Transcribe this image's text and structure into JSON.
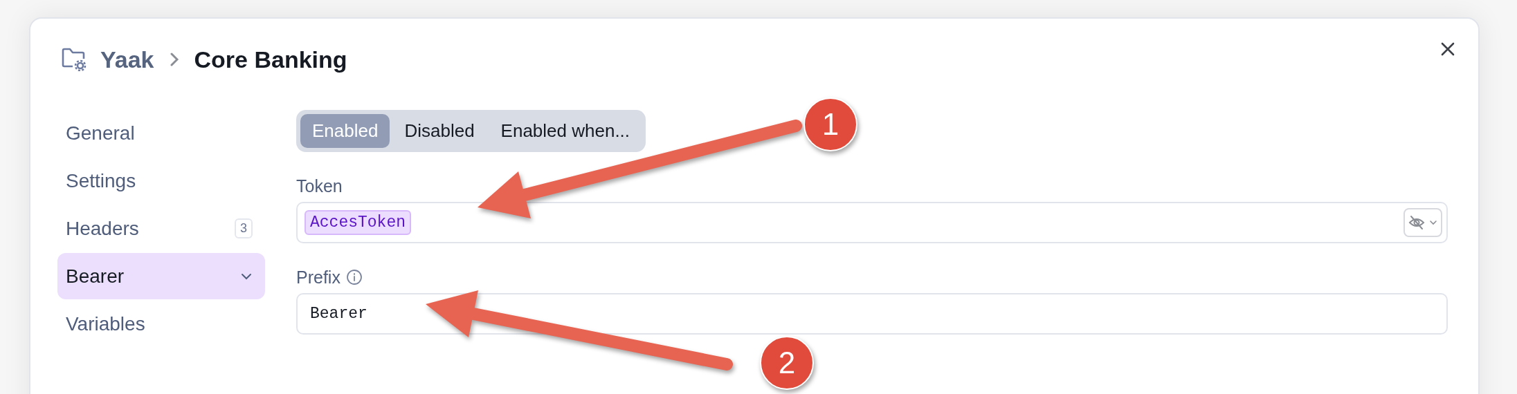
{
  "dialog": {
    "breadcrumb": {
      "parent": "Yaak",
      "current": "Core Banking"
    },
    "sidebar": {
      "items": [
        {
          "label": "General",
          "selected": false
        },
        {
          "label": "Settings",
          "selected": false
        },
        {
          "label": "Headers",
          "selected": false,
          "badge": "3"
        },
        {
          "label": "Bearer",
          "selected": true,
          "kind": "menu"
        },
        {
          "label": "Variables",
          "selected": false
        }
      ]
    },
    "segments": [
      {
        "label": "Enabled",
        "selected": true
      },
      {
        "label": "Disabled",
        "selected": false
      },
      {
        "label": "Enabled when...",
        "selected": false
      }
    ],
    "fields": [
      {
        "label": "Token",
        "kind": "variable",
        "value": "AccesToken",
        "info": false,
        "visibility_toggle": true
      },
      {
        "label": "Prefix",
        "kind": "text",
        "value": "Bearer",
        "info": true,
        "visibility_toggle": false
      }
    ]
  },
  "annotations": [
    {
      "number": "1"
    },
    {
      "number": "2"
    }
  ]
}
